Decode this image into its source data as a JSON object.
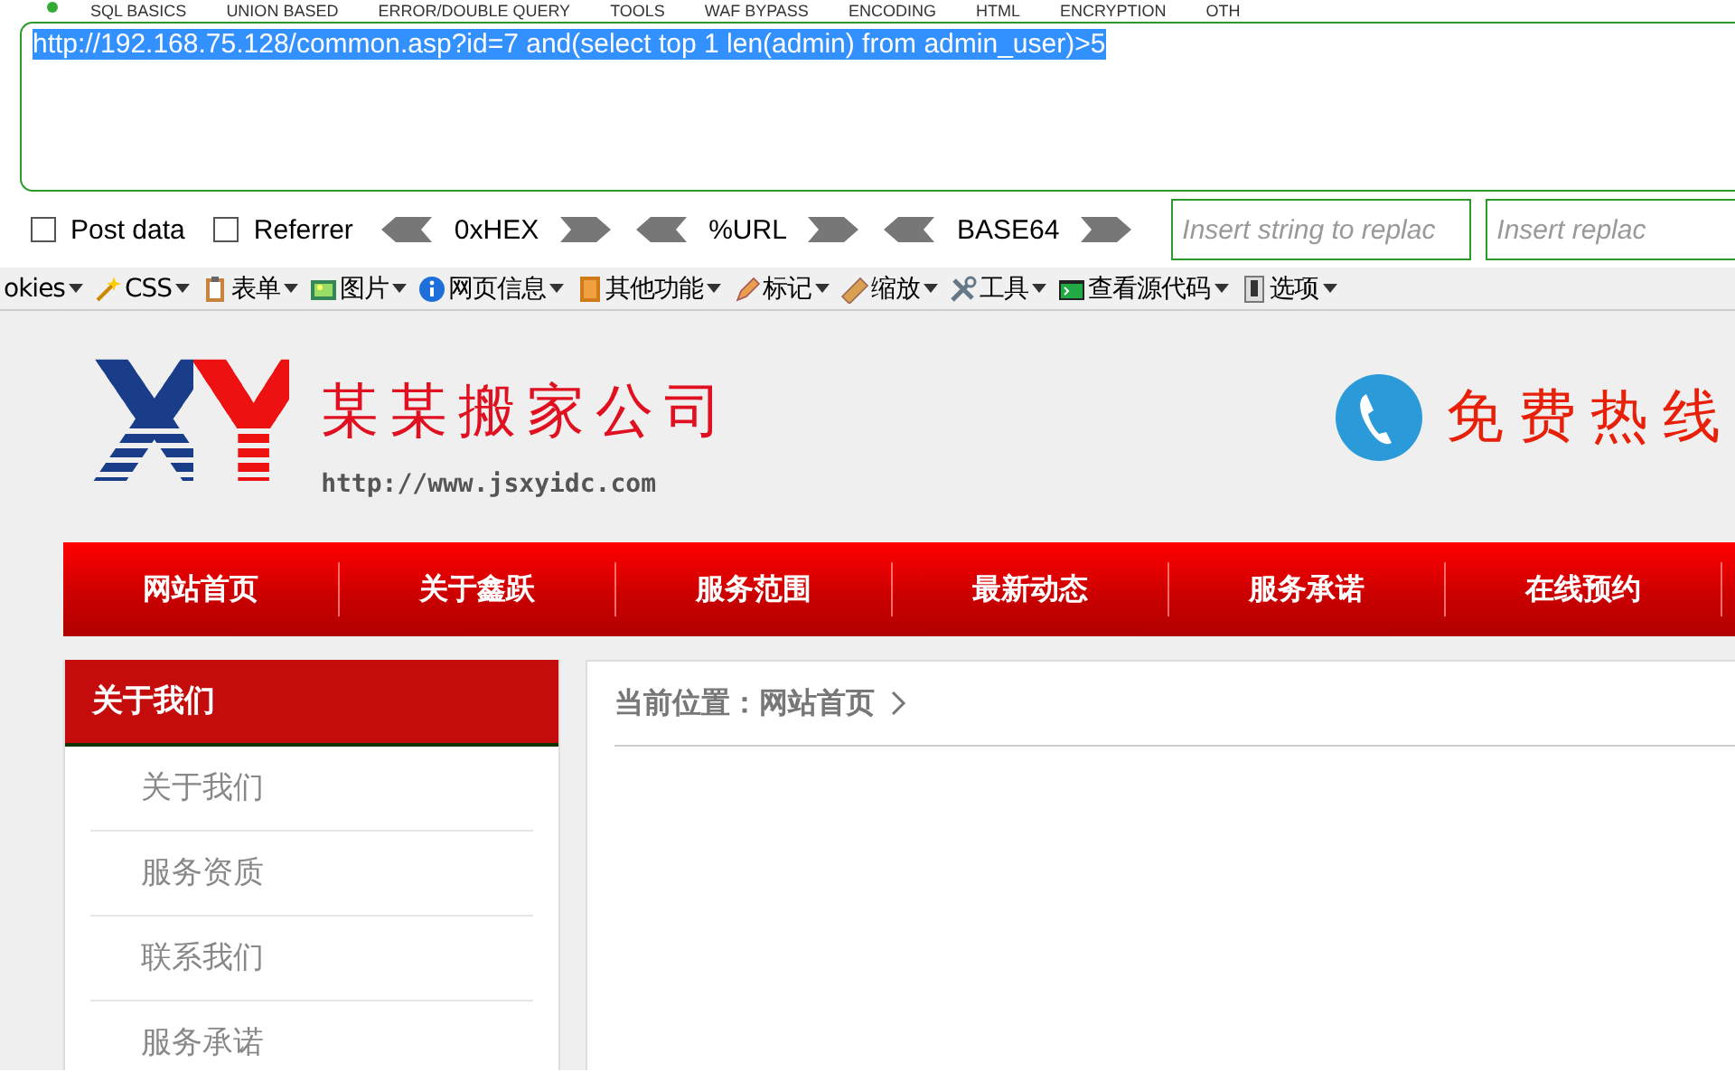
{
  "hackbar": {
    "menu": [
      "SQL BASICS",
      "UNION BASED",
      "ERROR/DOUBLE QUERY",
      "TOOLS",
      "WAF BYPASS",
      "ENCODING",
      "HTML",
      "ENCRYPTION",
      "OTH"
    ],
    "url": "http://192.168.75.128/common.asp?id=7 and(select top 1 len(admin) from admin_user)>5",
    "url_selected": true,
    "options": [
      {
        "label": "Post data",
        "checked": false
      },
      {
        "label": "Referrer",
        "checked": false
      }
    ],
    "encoders": [
      "0xHEX",
      "%URL",
      "BASE64"
    ],
    "replace_fields": [
      {
        "placeholder": "Insert string to replac"
      },
      {
        "placeholder": "Insert replac"
      }
    ]
  },
  "toolbar": [
    "okies",
    "CSS",
    "表单",
    "图片",
    "网页信息",
    "其他功能",
    "标记",
    "缩放",
    "工具",
    "查看源代码",
    "选项"
  ],
  "site": {
    "logo": {
      "mark": "XY",
      "company": "某某搬家公司",
      "url": "http://www.jsxyidc.com"
    },
    "hotline": "免费热线",
    "nav": [
      "网站首页",
      "关于鑫跃",
      "服务范围",
      "最新动态",
      "服务承诺",
      "在线预约"
    ],
    "sidebar": {
      "title": "关于我们",
      "items": [
        "关于我们",
        "服务资质",
        "联系我们",
        "服务承诺"
      ]
    },
    "breadcrumb": {
      "label": "当前位置：",
      "current": "网站首页"
    }
  }
}
